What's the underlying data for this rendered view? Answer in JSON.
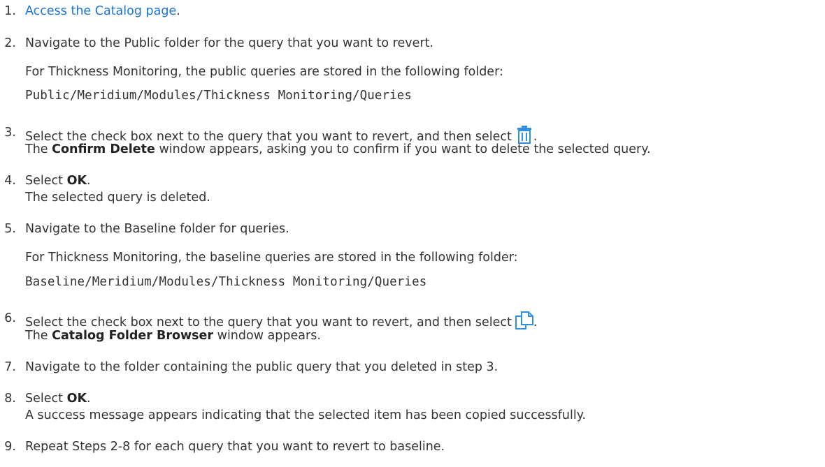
{
  "steps": [
    {
      "number": "1.",
      "link_text": "Access the Catalog page",
      "trail": "."
    },
    {
      "number": "2.",
      "text": "Navigate to the Public folder for the query that you want to revert.",
      "note": "For Thickness Monitoring, the public queries are stored in the following folder:",
      "path": "Public/Meridium/Modules/Thickness Monitoring/Queries"
    },
    {
      "number": "3.",
      "text": "Select the check box next to the query that you want to revert, and then select",
      "icon": "delete-trash-icon",
      "trail": ".",
      "result_pre": "The ",
      "result_bold": "Confirm Delete",
      "result_post": " window appears, asking you to confirm if you want to delete the selected query."
    },
    {
      "number": "4.",
      "pre": "Select ",
      "bold": "OK",
      "trail": ".",
      "result": "The selected query is deleted."
    },
    {
      "number": "5.",
      "text": "Navigate to the Baseline folder for queries.",
      "note": "For Thickness Monitoring, the baseline queries are stored in the following folder:",
      "path": "Baseline/Meridium/Modules/Thickness Monitoring/Queries"
    },
    {
      "number": "6.",
      "text": "Select the check box next to the query that you want to revert, and then select",
      "icon": "copy-icon",
      "trail": ".",
      "result_pre": "The ",
      "result_bold": "Catalog Folder Browser",
      "result_post": " window appears."
    },
    {
      "number": "7.",
      "text": "Navigate to the folder containing the public query that you deleted in step 3."
    },
    {
      "number": "8.",
      "pre": "Select ",
      "bold": "OK",
      "trail": ".",
      "result": "A success message appears indicating that the selected item has been copied successfully."
    },
    {
      "number": "9.",
      "text": "Repeat Steps 2-8 for each query that you want to revert to baseline."
    }
  ],
  "colors": {
    "text": "#333333",
    "link": "#1a73d6",
    "icon": "#2f8fe0"
  }
}
